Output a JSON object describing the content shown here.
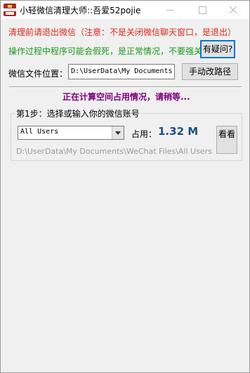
{
  "window": {
    "title": "小轻微信清理大师::吾爱52pojie"
  },
  "notices": {
    "exit_wechat": "清理前请退出微信（注意：不是关闭微信聊天窗口，是退出）",
    "freeze_warning": "操作过程中程序可能会假死，是正常情况，不要强关！"
  },
  "buttons": {
    "faq": "有疑问?",
    "change_path": "手动改路径",
    "view": "看看"
  },
  "path": {
    "label": "微信文件位置：",
    "value": "D:\\UserData\\My Documents"
  },
  "status": {
    "message": "正在计算空间占用情况，请稍等..."
  },
  "step1": {
    "legend": "第1步：选择或输入你的微信账号",
    "account_selected": "All Users",
    "usage_label": "占用：",
    "usage_value": "1.32 M",
    "account_path": "D:\\UserData\\My Documents\\WeChat Files\\All Users"
  },
  "colors": {
    "notice_red": "#e0281d",
    "notice_green": "#1a9a1a",
    "status_purple": "#800080",
    "usage_blue": "#1f4e8c",
    "path_gray": "#9a9a9a"
  },
  "icons": {
    "app": "broom-cleaner-icon",
    "minimize": "minimize-icon",
    "maximize": "maximize-icon",
    "close": "close-icon",
    "dropdown": "chevron-down-icon"
  }
}
